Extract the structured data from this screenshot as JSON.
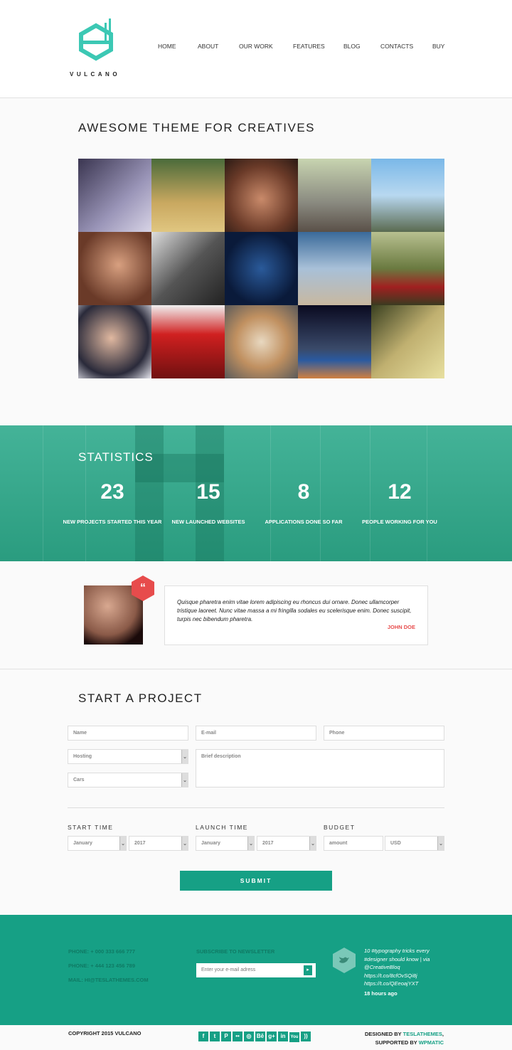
{
  "header": {
    "logo_text": "VULCANO",
    "nav": [
      "HOME",
      "ABOUT",
      "OUR WORK",
      "FEATURES",
      "BLOG",
      "CONTACTS",
      "BUY"
    ]
  },
  "gallery": {
    "title": "AWESOME THEME FOR CREATIVES"
  },
  "stats": {
    "title": "STATISTICS",
    "items": [
      {
        "value": "23",
        "label": "NEW PROJECTS STARTED THIS YEAR"
      },
      {
        "value": "15",
        "label": "NEW LAUNCHED WEBSITES"
      },
      {
        "value": "8",
        "label": "APPLICATIONS DONE SO FAR"
      },
      {
        "value": "12",
        "label": "PEOPLE WORKING FOR YOU"
      }
    ]
  },
  "testimonial": {
    "quote_icon": "“",
    "text": "Quisque pharetra enim vitae lorem adipiscing eu rhoncus dui ornare. Donec ullamcorper tristique laoreet. Nunc vitae massa a mi fringilla sodales eu scelerisque enim. Donec suscipit, turpis nec bibendum pharetra.",
    "author": "JOHN DOE"
  },
  "form": {
    "title": "START A PROJECT",
    "name_ph": "Name",
    "email_ph": "E-mail",
    "phone_ph": "Phone",
    "hosting": "Hosting",
    "cars": "Cars",
    "desc_ph": "Brief description",
    "start_label": "START TIME",
    "launch_label": "LAUNCH TIME",
    "budget_label": "BUDGET",
    "start_month": "January",
    "start_year": "2017",
    "launch_month": "January",
    "launch_year": "2017",
    "amount_ph": "amount",
    "currency": "USD",
    "submit": "SUBMIT"
  },
  "footer": {
    "phone1": "PHONE: + 000 333 666 777",
    "phone2": "PHONE: + 444 123 456 789",
    "mail": "MAIL: HI@TESLATHEMES.COM",
    "newsletter_title": "SUBSCRIBE TO NEWSLETTER",
    "email_ph": "Enter your e-mail adress",
    "tweet": "10 #typography tricks every #designer should know | via @CreativeBloq https://t.co/8cfOvSQi8j https://t.co/QEeoajYXT",
    "tweet_time": "18 hours ago"
  },
  "bottom": {
    "copyright": "COPYRIGHT 2015 VULCANO",
    "designed_by": "DESIGNED BY",
    "designer": "TESLATHEMES",
    "supported_by": "SUPPORTED BY",
    "supporter": "WPMATIC",
    "social": [
      "f",
      "t",
      "P",
      "••",
      "◎",
      "Bē",
      "g+",
      "in",
      "You",
      "))"
    ]
  },
  "colors": {
    "accent": "#16a085",
    "stats_bg": "#3aaa90",
    "quote_red": "#e74c4c",
    "logo": "#3cc8b4"
  }
}
